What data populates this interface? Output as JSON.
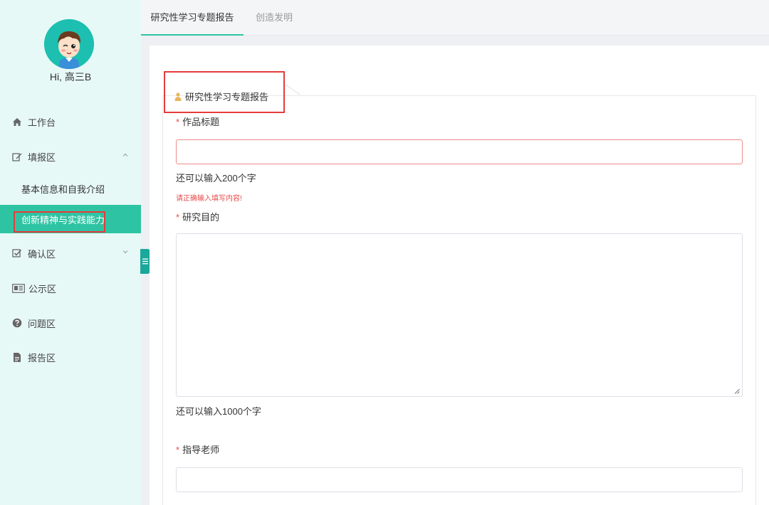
{
  "user": {
    "greeting": "Hi, 高三B"
  },
  "sidebar": {
    "items": [
      {
        "label": "工作台",
        "icon": "home-icon"
      },
      {
        "label": "填报区",
        "icon": "edit-icon",
        "expanded": true
      },
      {
        "label": "确认区",
        "icon": "check-square-icon",
        "expanded": false
      },
      {
        "label": "公示区",
        "icon": "newspaper-icon"
      },
      {
        "label": "问题区",
        "icon": "question-circle-icon"
      },
      {
        "label": "报告区",
        "icon": "file-icon"
      }
    ],
    "subitems": [
      {
        "label": "基本信息和自我介绍"
      },
      {
        "label": "创新精神与实践能力",
        "active": true
      }
    ]
  },
  "tabs": [
    {
      "label": "研究性学习专题报告",
      "active": true
    },
    {
      "label": "创造发明",
      "active": false
    }
  ],
  "form": {
    "section_title": "研究性学习专题报告",
    "fields": [
      {
        "label": "作品标题",
        "required": true,
        "value": "",
        "hint": "还可以输入200个字",
        "error": "请正确输入填写内容!"
      },
      {
        "label": "研究目的",
        "required": true,
        "value": "",
        "hint": "还可以输入1000个字"
      },
      {
        "label": "指导老师",
        "required": true,
        "value": ""
      }
    ]
  },
  "colors": {
    "accent": "#2ec4a3",
    "sidebar_bg": "#e7f9f7",
    "error": "#e64c4c",
    "highlight": "#e63b3b"
  }
}
